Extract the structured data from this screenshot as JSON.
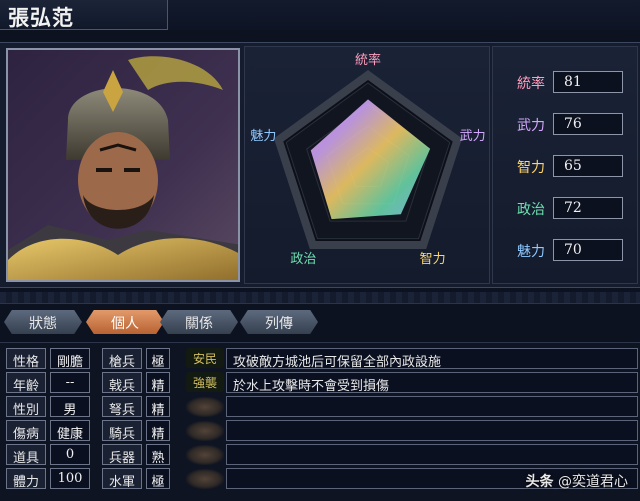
{
  "officer": {
    "name": "張弘范"
  },
  "chart": {
    "axes": [
      {
        "label": "統率",
        "color": "#ff9fbd"
      },
      {
        "label": "武力",
        "color": "#d5a8ff"
      },
      {
        "label": "智力",
        "color": "#ffd56a"
      },
      {
        "label": "政治",
        "color": "#6ee0b0"
      },
      {
        "label": "魅力",
        "color": "#8ec8ff"
      }
    ]
  },
  "chart_data": {
    "type": "radar",
    "axes": [
      "統率",
      "武力",
      "智力",
      "政治",
      "魅力"
    ],
    "values": [
      81,
      76,
      65,
      72,
      70
    ],
    "max": 100
  },
  "stats": [
    {
      "label": "統率",
      "value": "81",
      "color": "#ff9fbd"
    },
    {
      "label": "武力",
      "value": "76",
      "color": "#d5a8ff"
    },
    {
      "label": "智力",
      "value": "65",
      "color": "#ffd56a"
    },
    {
      "label": "政治",
      "value": "72",
      "color": "#6ee0b0"
    },
    {
      "label": "魅力",
      "value": "70",
      "color": "#8ec8ff"
    }
  ],
  "tabs": [
    "狀態",
    "個人",
    "關係",
    "列傳"
  ],
  "active_tab": "個人",
  "personal": [
    {
      "label": "性格",
      "value": "剛膽"
    },
    {
      "label": "年齡",
      "value": "--"
    },
    {
      "label": "性別",
      "value": "男"
    },
    {
      "label": "傷病",
      "value": "健康"
    },
    {
      "label": "道具",
      "value": "0"
    },
    {
      "label": "體力",
      "value": "100"
    }
  ],
  "troops": [
    {
      "label": "槍兵",
      "value": "極"
    },
    {
      "label": "戟兵",
      "value": "精"
    },
    {
      "label": "弩兵",
      "value": "精"
    },
    {
      "label": "騎兵",
      "value": "精"
    },
    {
      "label": "兵器",
      "value": "熟"
    },
    {
      "label": "水軍",
      "value": "極"
    }
  ],
  "skills": [
    {
      "name": "安民",
      "desc": "攻破敵方城池后可保留全部內政設施"
    },
    {
      "name": "強襲",
      "desc": "於水上攻擊時不會受到損傷"
    },
    {
      "name": "",
      "desc": ""
    },
    {
      "name": "",
      "desc": ""
    },
    {
      "name": "",
      "desc": ""
    },
    {
      "name": "",
      "desc": ""
    }
  ],
  "watermark": {
    "brand": "头条",
    "handle": "@奕道君心"
  }
}
